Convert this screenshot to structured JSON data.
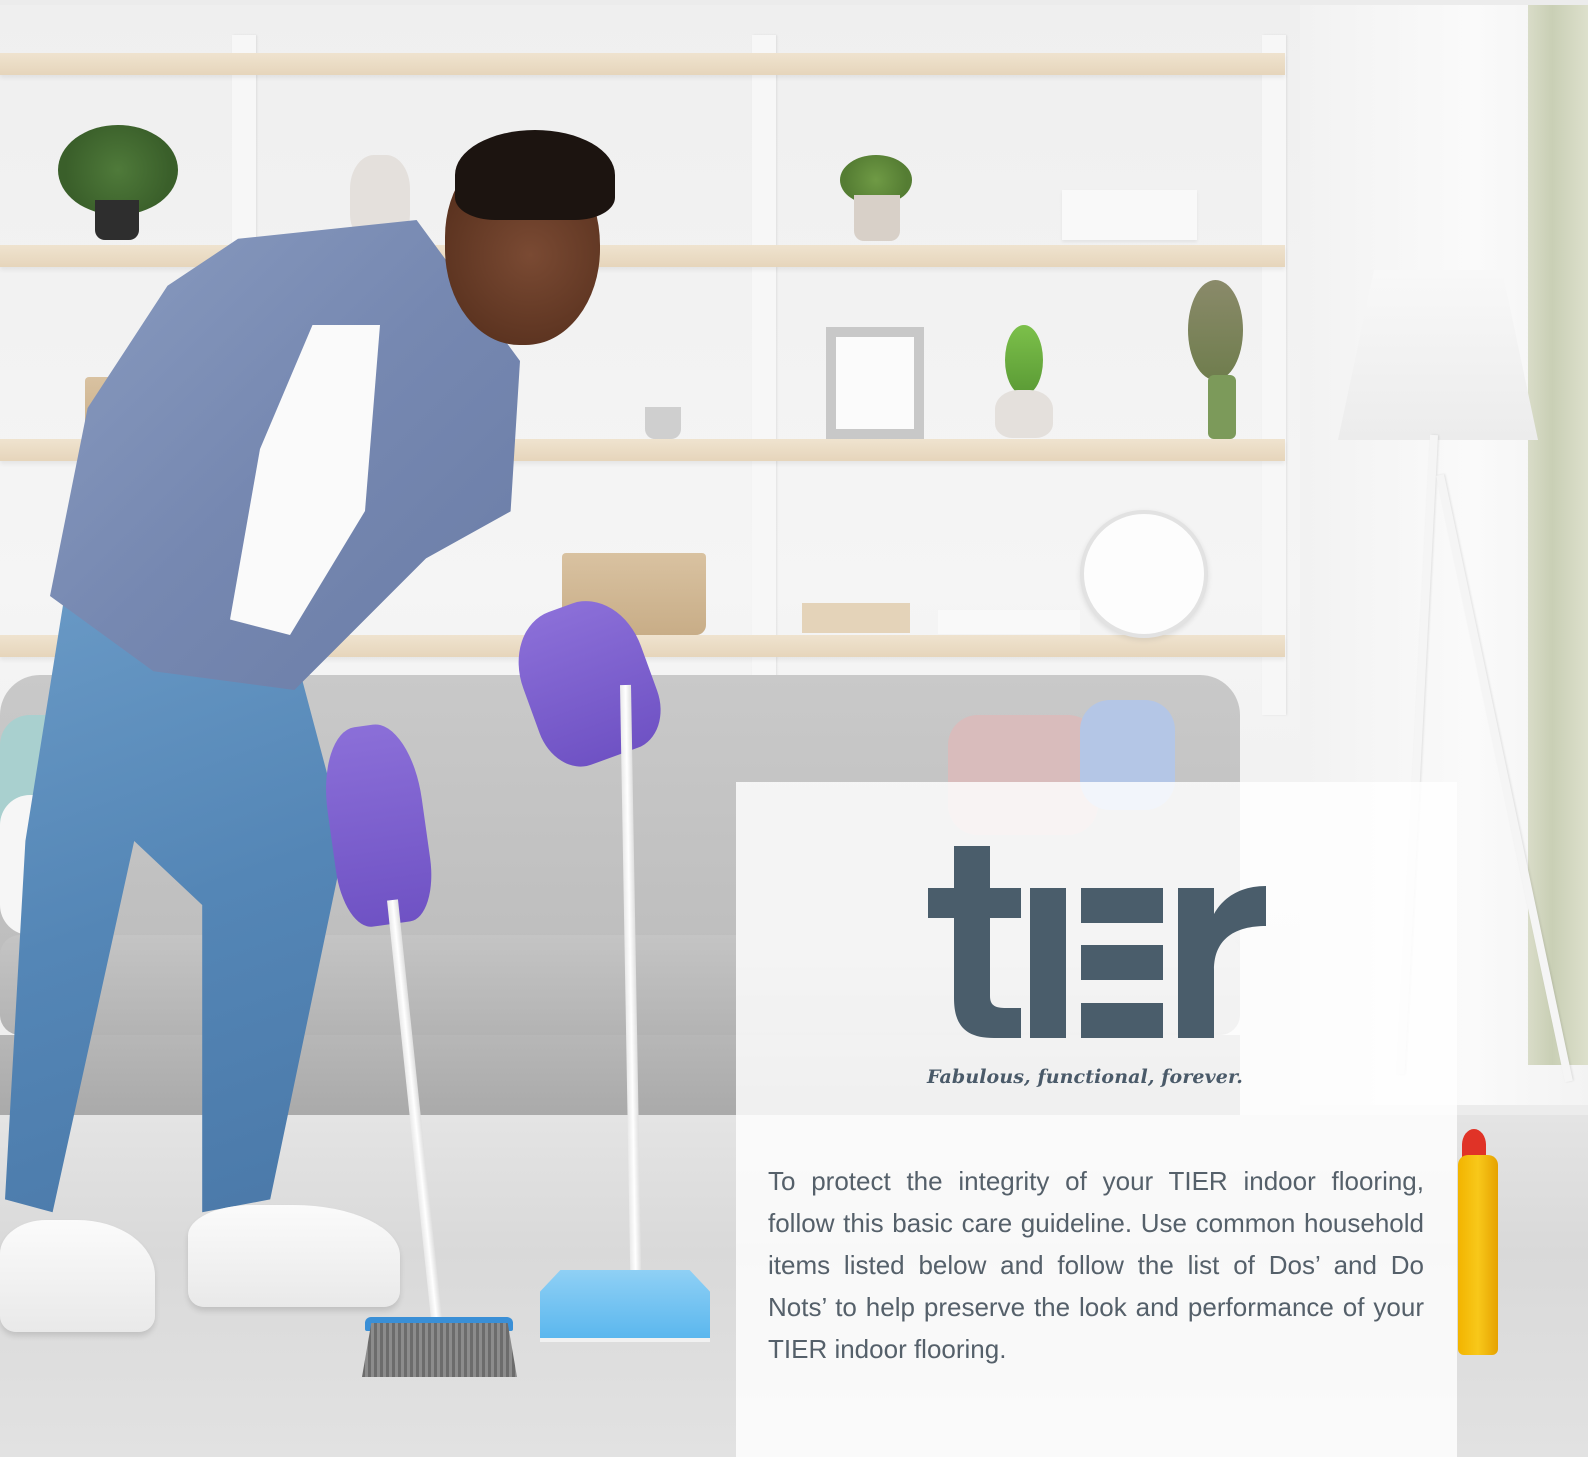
{
  "brand": {
    "logo_text": "tier",
    "tagline": "Fabulous, functional, forever.",
    "logo_color": "#4a5d6b"
  },
  "intro": {
    "text": "To protect the integrity of your TIER indoor flooring, follow this basic care guideline. Use common household items listed below and follow the list of Dos’ and Do Nots’ to help preserve the look and performance of your TIER indoor flooring."
  },
  "colors": {
    "text": "#55606a",
    "card_overlay": "rgba(255,255,255,0.82)",
    "glove": "#7a5fcf",
    "dustpan": "#5bb7ee"
  }
}
